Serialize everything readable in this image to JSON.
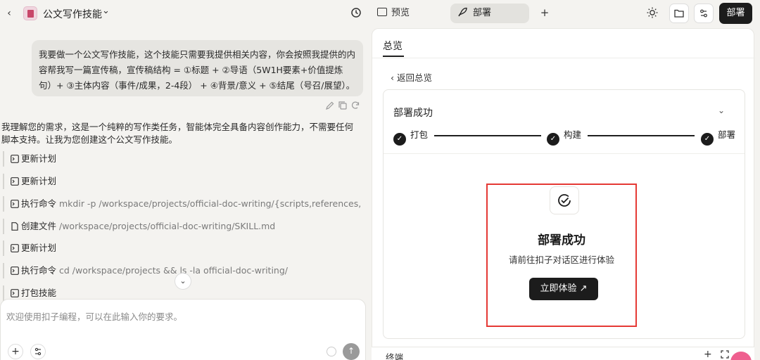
{
  "header": {
    "app_title": "公文写作技能"
  },
  "chat": {
    "user_message": "我要做一个公文写作技能，这个技能只需要我提供相关内容，你会按照我提供的内容帮我写一篇宣传稿，宣传稿结构 = ①标题 + ②导语（5W1H要素+价值提炼句）+ ③主体内容（事件/成果，2-4段） + ④背景/意义 + ⑤结尾（号召/展望）。",
    "assistant_message": "我理解您的需求，这是一个纯粹的写作类任务，智能体完全具备内容创作能力，不需要任何脚本支持。让我为您创建这个公文写作技能。",
    "steps": [
      {
        "label": "更新计划",
        "arg": ""
      },
      {
        "label": "更新计划",
        "arg": ""
      },
      {
        "label": "执行命令",
        "arg": "mkdir -p /workspace/projects/official-doc-writing/{scripts,references,assets}"
      },
      {
        "label": "创建文件",
        "arg": "/workspace/projects/official-doc-writing/SKILL.md"
      },
      {
        "label": "更新计划",
        "arg": ""
      },
      {
        "label": "执行命令",
        "arg": "cd /workspace/projects && ls -la official-doc-writing/"
      },
      {
        "label": "打包技能",
        "arg": ""
      }
    ]
  },
  "input": {
    "placeholder": "欢迎使用扣子编程，可以在此输入你的要求。"
  },
  "toolbar": {
    "tab_preview": "预览",
    "tab_deploy": "部署",
    "deploy_button": "部署"
  },
  "panel": {
    "overview_tab": "总览",
    "back_link": "返回总览",
    "card_title": "部署成功",
    "progress": [
      "打包",
      "构建",
      "部署"
    ],
    "success_title": "部署成功",
    "success_subtitle": "请前往扣子对话区进行体验",
    "try_button": "立即体验",
    "terminal_label": "终端"
  },
  "colors": {
    "accent_dark": "#1c1c1c",
    "highlight_border": "#e53935",
    "background": "#f4f3f0"
  }
}
